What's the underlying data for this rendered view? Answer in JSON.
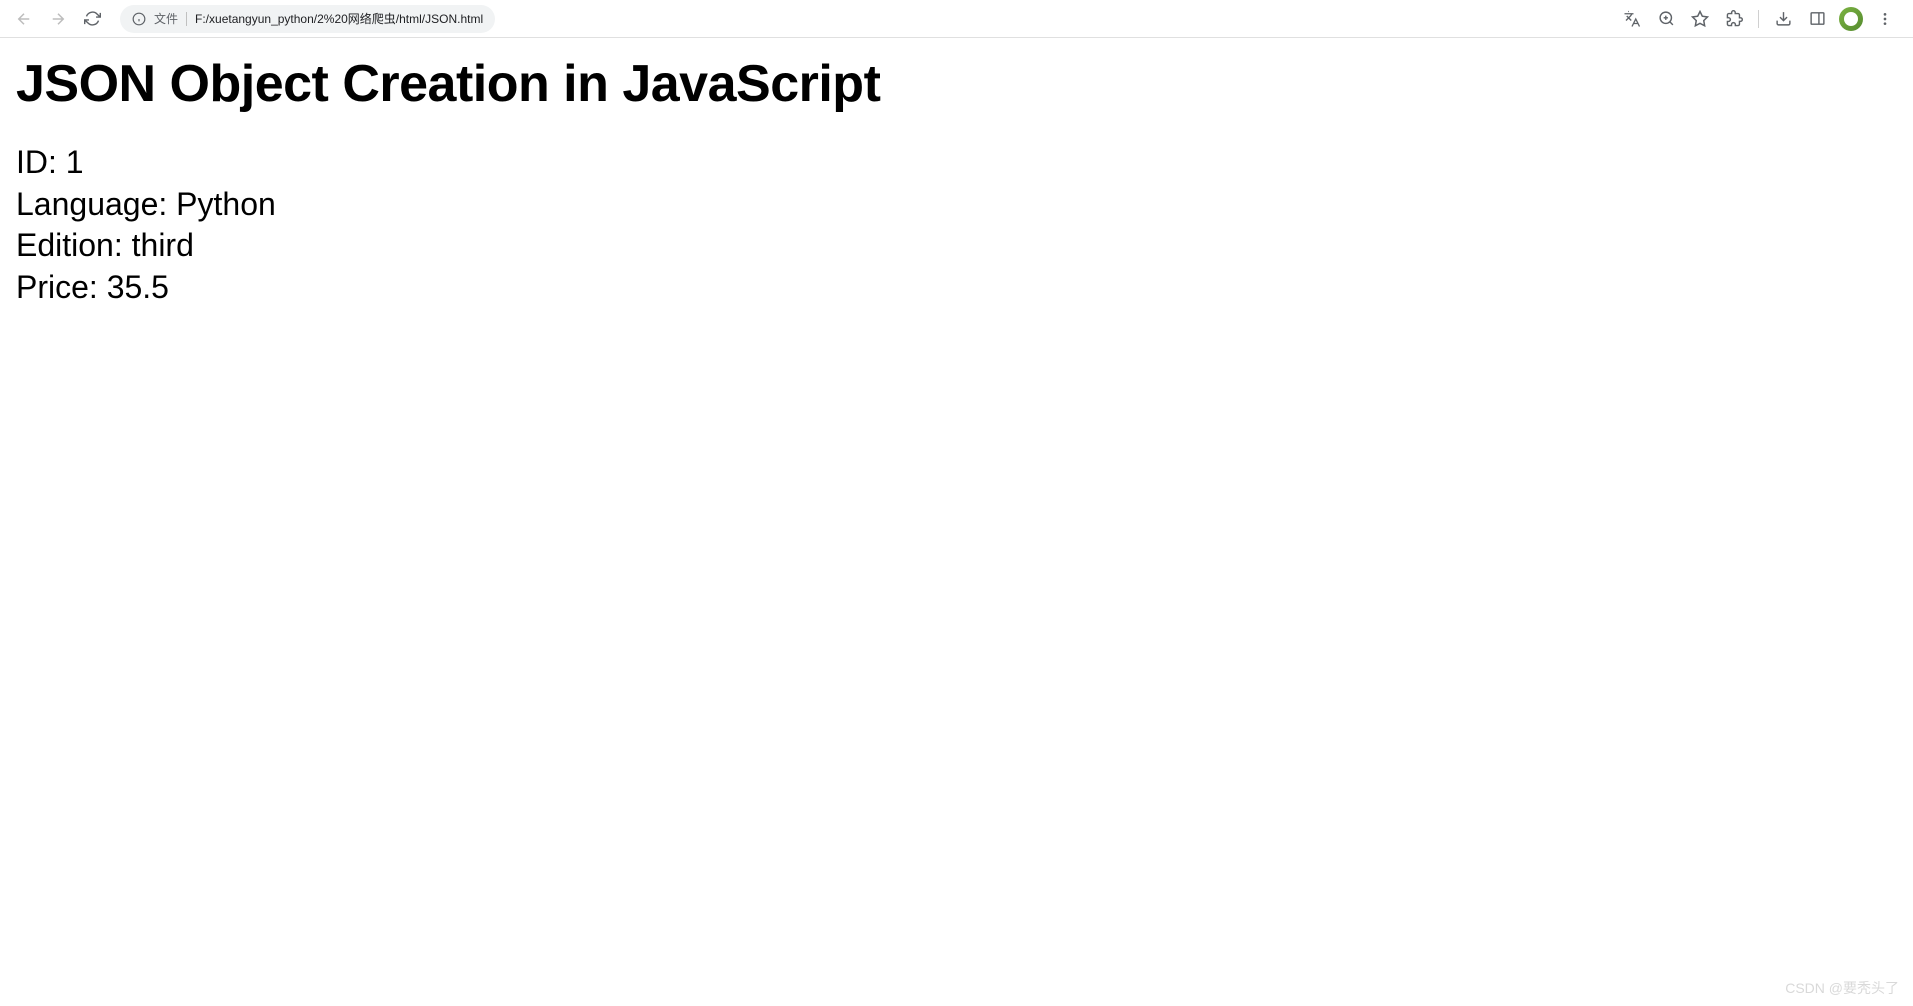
{
  "browser": {
    "address_bar": {
      "file_label": "文件",
      "url": "F:/xuetangyun_python/2%20网络爬虫/html/JSON.html"
    }
  },
  "page": {
    "title": "JSON Object Creation in JavaScript",
    "lines": {
      "id": "ID: 1",
      "language": "Language: Python",
      "edition": "Edition: third",
      "price": "Price: 35.5"
    }
  },
  "watermark": "CSDN @要秃头了"
}
